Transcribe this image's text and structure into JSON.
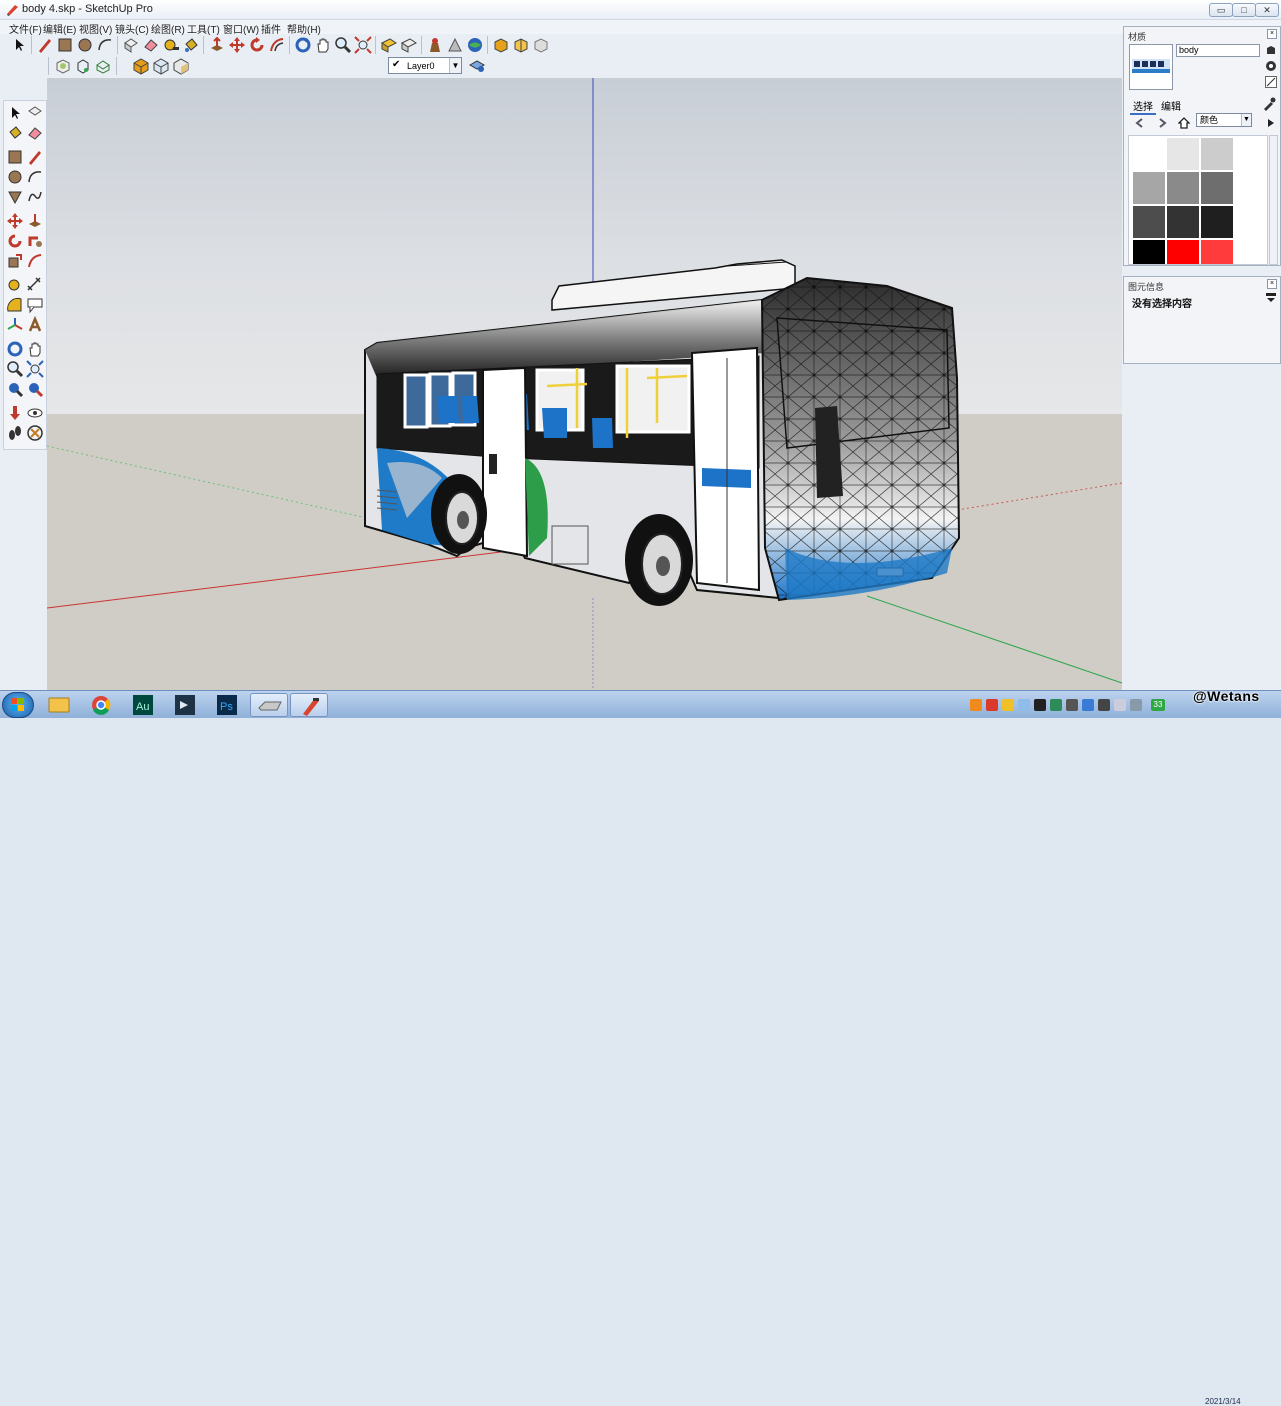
{
  "window": {
    "title": "body 4.skp - SketchUp Pro",
    "controls": {
      "minimize": "▭",
      "maximize": "□",
      "close": "✕"
    }
  },
  "menu": [
    "文件(F)",
    "编辑(E)",
    "视图(V)",
    "镜头(C)",
    "绘图(R)",
    "工具(T)",
    "窗口(W)",
    "插件",
    "帮助(H)"
  ],
  "layers": {
    "current": "Layer0"
  },
  "materials_panel": {
    "title": "材质",
    "name_value": "body",
    "tabs": [
      "选择",
      "编辑"
    ],
    "collection": "颜色",
    "swatches": [
      "#ffffff",
      "#e6e6e6",
      "#cccccc",
      "#a6a6a6",
      "#8a8a8a",
      "#6e6e6e",
      "#4d4d4d",
      "#333333",
      "#1f1f1f",
      "#000000",
      "#ff0000",
      "#ff3b3b"
    ]
  },
  "entity_panel": {
    "title": "图元信息",
    "status": "没有选择内容"
  },
  "taskbar": {
    "apps": [
      "explorer-icon",
      "chrome-icon",
      "audition-icon",
      "premiere-icon",
      "photoshop-icon",
      "sketchup-file-icon",
      "sketchup-icon"
    ],
    "tray_badge": "33",
    "date": "2021/3/14"
  },
  "watermark": "@Wetans"
}
